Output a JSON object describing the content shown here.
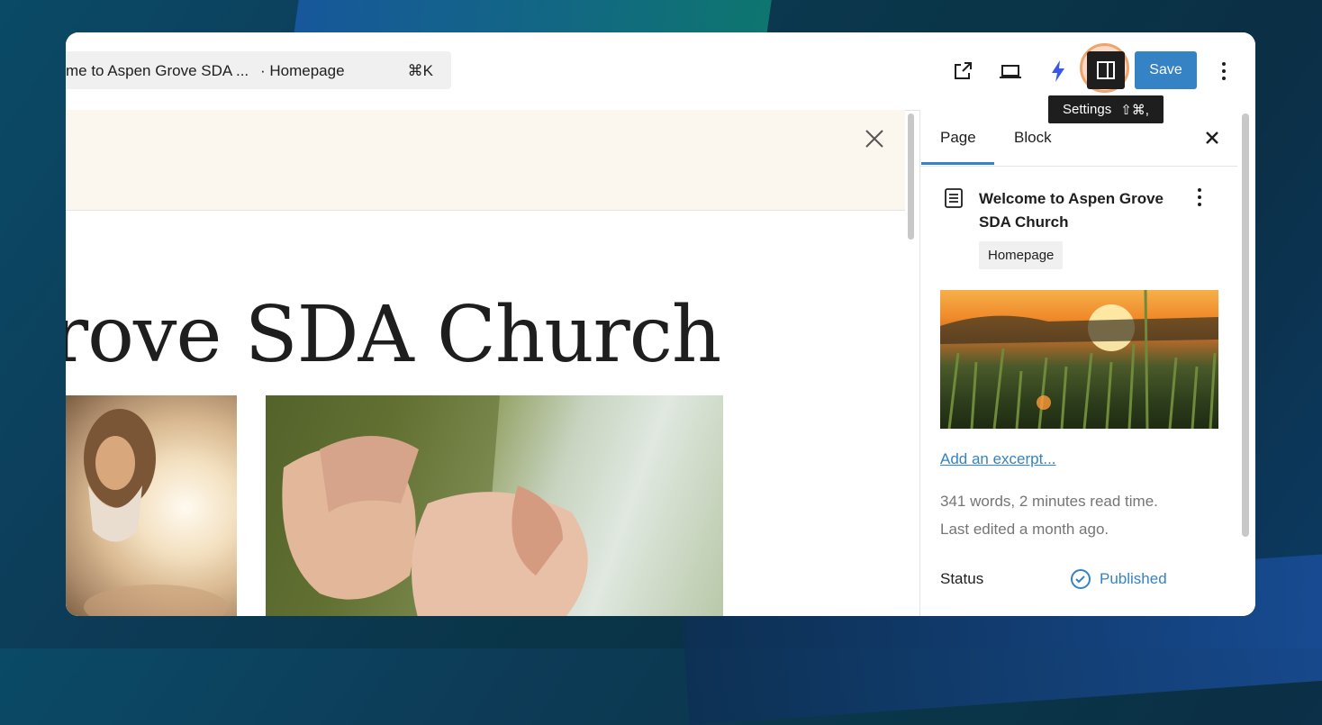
{
  "topbar": {
    "command": {
      "title": "me to Aspen Grove SDA ...",
      "subtitle": "· Homepage",
      "shortcut": "⌘K"
    },
    "icons": [
      "external-link-icon",
      "device-preview-icon",
      "lightning-icon",
      "settings-icon",
      "more-vertical-icon"
    ],
    "save_label": "Save",
    "tooltip": {
      "label": "Settings",
      "shortcut": "⇧⌘,"
    }
  },
  "canvas": {
    "hero_title": "rove SDA Church"
  },
  "sidebar": {
    "tabs": [
      {
        "label": "Page"
      },
      {
        "label": "Block"
      }
    ],
    "page_title": "Welcome to Aspen Grove SDA Church",
    "template_badge": "Homepage",
    "excerpt_link": "Add an excerpt...",
    "stats": "341 words, 2 minutes read time.",
    "last_edited": "Last edited a month ago.",
    "status": {
      "label": "Status",
      "value": "Published"
    }
  },
  "colors": {
    "accent": "#3582c4",
    "dark": "#1e1e1e",
    "notice_bg": "#fbf7ee",
    "highlight": "#f0a36a"
  }
}
